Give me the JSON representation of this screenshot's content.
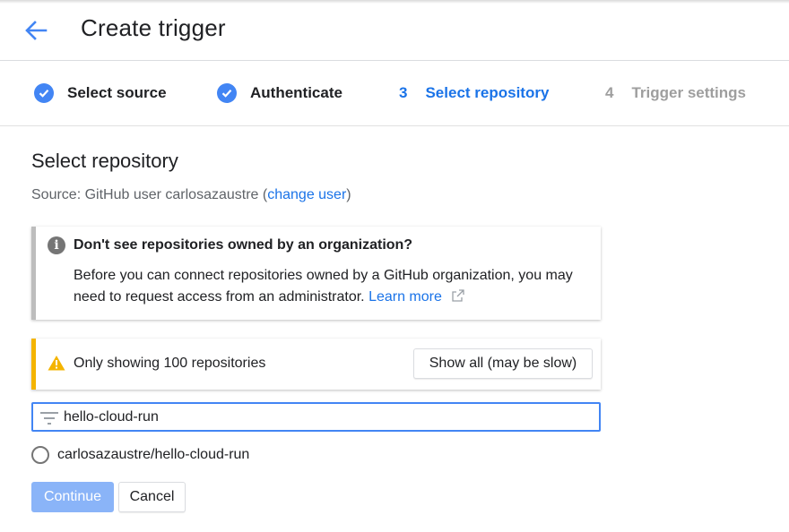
{
  "header": {
    "title": "Create trigger",
    "back_icon": "arrow-back-icon"
  },
  "stepper": {
    "steps": [
      {
        "label": "Select source",
        "state": "done"
      },
      {
        "label": "Authenticate",
        "state": "done"
      },
      {
        "number": "3",
        "label": "Select repository",
        "state": "active"
      },
      {
        "number": "4",
        "label": "Trigger settings",
        "state": "future"
      }
    ]
  },
  "main": {
    "section_title": "Select repository",
    "source": {
      "prefix": "Source: GitHub user carlosazaustre (",
      "link": "change user",
      "suffix": ")"
    },
    "info_card": {
      "icon": "info-icon",
      "heading": "Don't see repositories owned by an organization?",
      "body": "Before you can connect repositories owned by a GitHub organization, you may need to request access from an administrator.",
      "link": "Learn more",
      "link_icon": "external-link-icon"
    },
    "warning_card": {
      "icon": "warning-icon",
      "text": "Only showing 100 repositories",
      "button": "Show all (may be slow)"
    },
    "filter": {
      "icon": "filter-icon",
      "value": "hello-cloud-run"
    },
    "repositories": [
      {
        "name": "carlosazaustre/hello-cloud-run",
        "selected": false
      }
    ],
    "actions": {
      "continue": "Continue",
      "cancel": "Cancel"
    }
  },
  "colors": {
    "accent": "#1a73e8",
    "check": "#4285f4",
    "warning": "#f4b400",
    "continue_disabled": "#8ab4f8"
  }
}
